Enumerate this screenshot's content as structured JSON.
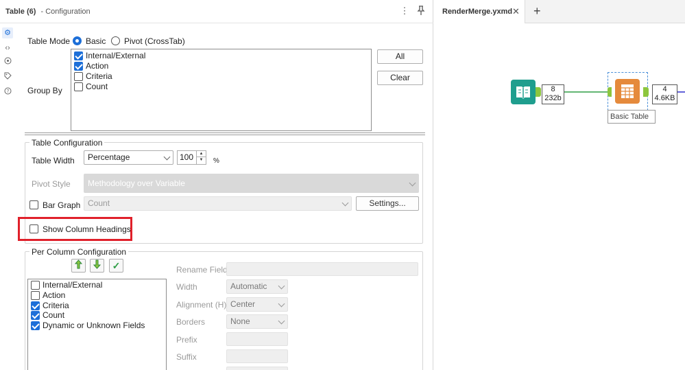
{
  "panel": {
    "title": "Table (6)",
    "subtitle": "- Configuration"
  },
  "table_mode": {
    "label": "Table Mode",
    "options": [
      "Basic",
      "Pivot (CrossTab)"
    ],
    "selected": "Basic"
  },
  "group_by": {
    "label": "Group By",
    "items": [
      {
        "label": "Internal/External",
        "checked": true
      },
      {
        "label": "Action",
        "checked": true
      },
      {
        "label": "Criteria",
        "checked": false
      },
      {
        "label": "Count",
        "checked": false
      }
    ],
    "all_label": "All",
    "clear_label": "Clear"
  },
  "table_config": {
    "title": "Table Configuration",
    "width_label": "Table Width",
    "width_mode": "Percentage",
    "width_value": "100",
    "width_unit": "%",
    "pivot_style_label": "Pivot Style",
    "pivot_style_value": "Methodology over Variable",
    "bar_graph_label": "Bar Graph",
    "bar_graph_checked": false,
    "bar_graph_field": "Count",
    "settings_label": "Settings...",
    "show_headings_label": "Show Column Headings",
    "show_headings_checked": false
  },
  "per_column": {
    "title": "Per Column Configuration",
    "fields": [
      {
        "label": "Internal/External",
        "checked": false
      },
      {
        "label": "Action",
        "checked": false
      },
      {
        "label": "Criteria",
        "checked": true
      },
      {
        "label": "Count",
        "checked": true
      },
      {
        "label": "Dynamic or Unknown Fields",
        "checked": true
      }
    ],
    "rename_field_label": "Rename Field",
    "width_label": "Width",
    "width_value": "Automatic",
    "alignment_label": "Alignment (H)",
    "alignment_value": "Center",
    "borders_label": "Borders",
    "borders_value": "None",
    "prefix_label": "Prefix",
    "suffix_label": "Suffix"
  },
  "canvas": {
    "tab_label": "RenderMerge.yxmd",
    "input_count": "8",
    "input_size": "232b",
    "tool_label": "Basic Table",
    "output_count": "4",
    "output_size": "4.6KB"
  },
  "colors": {
    "accent": "#1d6fd8",
    "highlight": "#e0202a",
    "input_tool": "#1f9e8e",
    "table_tool": "#e58a3c",
    "connector": "#2e9e45"
  }
}
